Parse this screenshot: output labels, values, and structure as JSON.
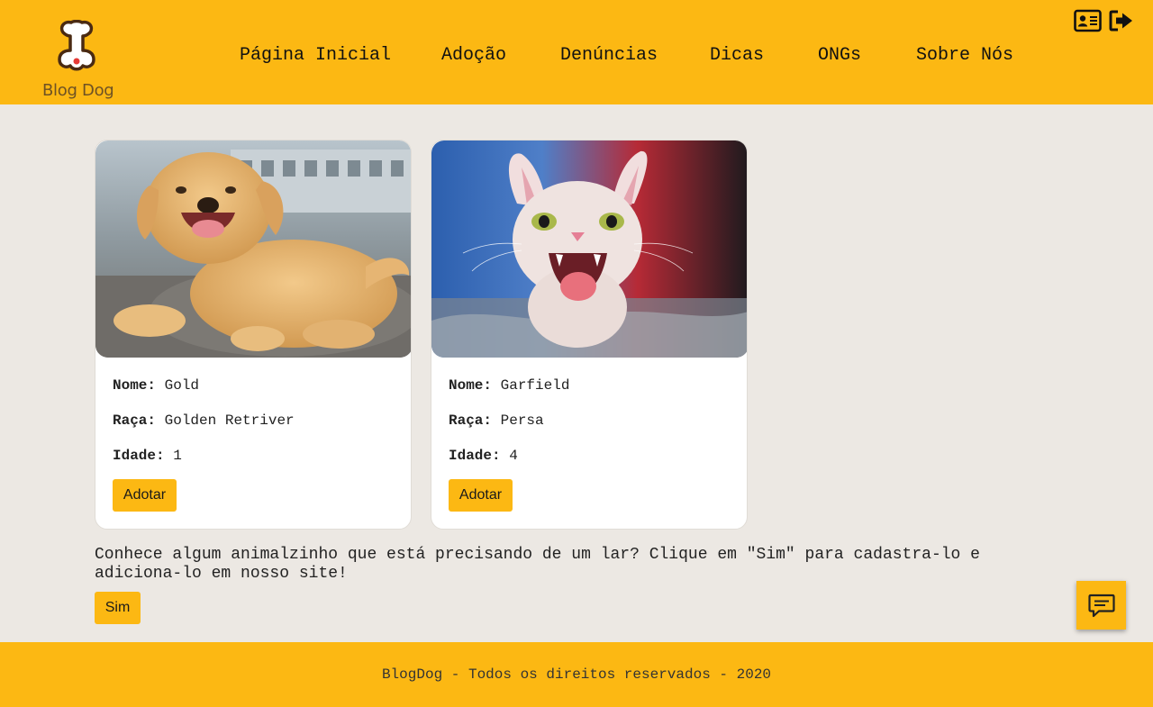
{
  "brand": {
    "name": "Blog Dog"
  },
  "nav": [
    "Página Inicial",
    "Adoção",
    "Denúncias",
    "Dicas",
    "ONGs",
    "Sobre Nós"
  ],
  "header_icons": [
    "id-card-icon",
    "sign-out-icon"
  ],
  "labels": {
    "nome": "Nome:",
    "raca": "Raça:",
    "idade": "Idade:"
  },
  "pets": [
    {
      "photo": "golden-retriever-puppy-photo",
      "nome": "Gold",
      "raca": "Golden Retriver",
      "idade": "1",
      "button": "Adotar"
    },
    {
      "photo": "sphynx-cat-photo",
      "nome": "Garfield",
      "raca": "Persa",
      "idade": "4",
      "button": "Adotar"
    }
  ],
  "prompt": {
    "text": "Conhece algum animalzinho que está precisando de um lar? Clique em \"Sim\" para cadastra-lo e adiciona-lo em nosso site!",
    "button": "Sim"
  },
  "footer": "BlogDog - Todos os direitos reservados - 2020",
  "chat_icon": "chat-icon",
  "colors": {
    "accent": "#fcb813",
    "background": "#ece8e3"
  }
}
